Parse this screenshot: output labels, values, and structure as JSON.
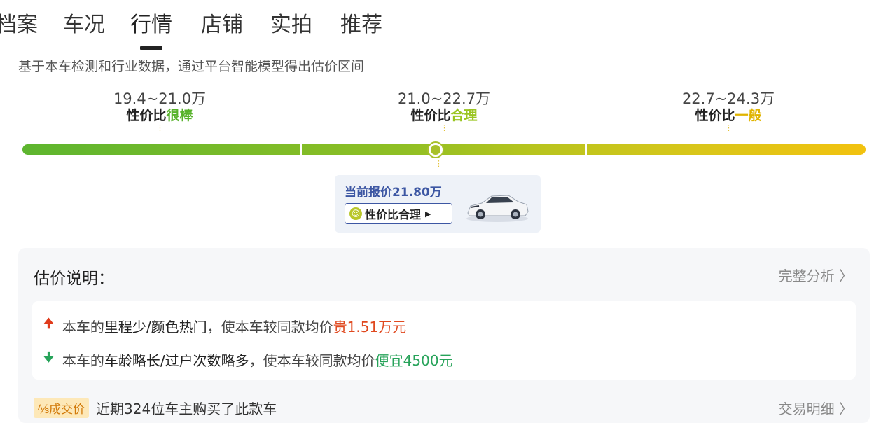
{
  "tabs": [
    {
      "label": "档案"
    },
    {
      "label": "车况"
    },
    {
      "label": "行情",
      "active": true
    },
    {
      "label": "店铺"
    },
    {
      "label": "实拍"
    },
    {
      "label": "推荐"
    }
  ],
  "subtitle": "基于本车检测和行业数据，通过平台智能模型得出估价区间",
  "ranges": [
    {
      "price": "19.4~21.0万",
      "prefix": "性价比",
      "rating": "很棒",
      "color": "#56b22a"
    },
    {
      "price": "21.0~22.7万",
      "prefix": "性价比",
      "rating": "合理",
      "color": "#9ac520"
    },
    {
      "price": "22.7~24.3万",
      "prefix": "性价比",
      "rating": "一般",
      "color": "#e0b400"
    }
  ],
  "current_price": {
    "label": "当前报价21.80万",
    "badge": "性价比合理",
    "icon": "smile-face-icon",
    "car_image": "white-sedan-image"
  },
  "estimate": {
    "title": "估价说明：",
    "link": "完整分析",
    "reasons": [
      {
        "direction": "up",
        "prefix": "本车的",
        "emphasis": "里程少/颜色热门",
        "middle": "，使本车较同款均价",
        "result": "贵1.51万元"
      },
      {
        "direction": "down",
        "prefix": "本车的",
        "emphasis": "车龄略长/过户次数略多",
        "middle": "，使本车较同款均价",
        "result": "便宜4500元"
      }
    ]
  },
  "deal": {
    "tag": "成交价",
    "text": "近期324位车主购买了此款车",
    "link": "交易明细"
  },
  "colors": {
    "accent_blue": "#3d57a3",
    "up": "#e03b1b",
    "down": "#27a35a",
    "tag_bg": "#fde8b8"
  }
}
